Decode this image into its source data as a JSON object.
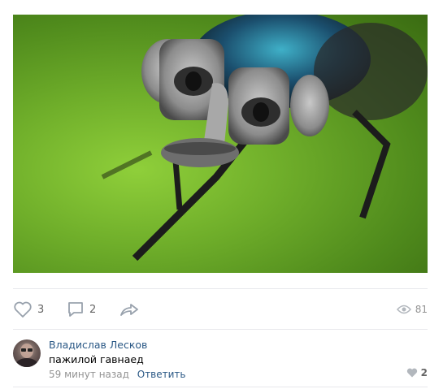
{
  "post": {
    "image_alt_icon": "photo-fly-with-face-icon",
    "likes": "3",
    "comments": "2",
    "views": "81"
  },
  "comment": {
    "author": "Владислав Лесков",
    "text": "пажилой гавнаед",
    "time": "59 минут назад",
    "reply_label": "Ответить",
    "likes": "2"
  },
  "colors": {
    "link": "#2a5885",
    "muted": "#939393",
    "icon": "#99a2ad",
    "divider": "#e7e8ec"
  }
}
